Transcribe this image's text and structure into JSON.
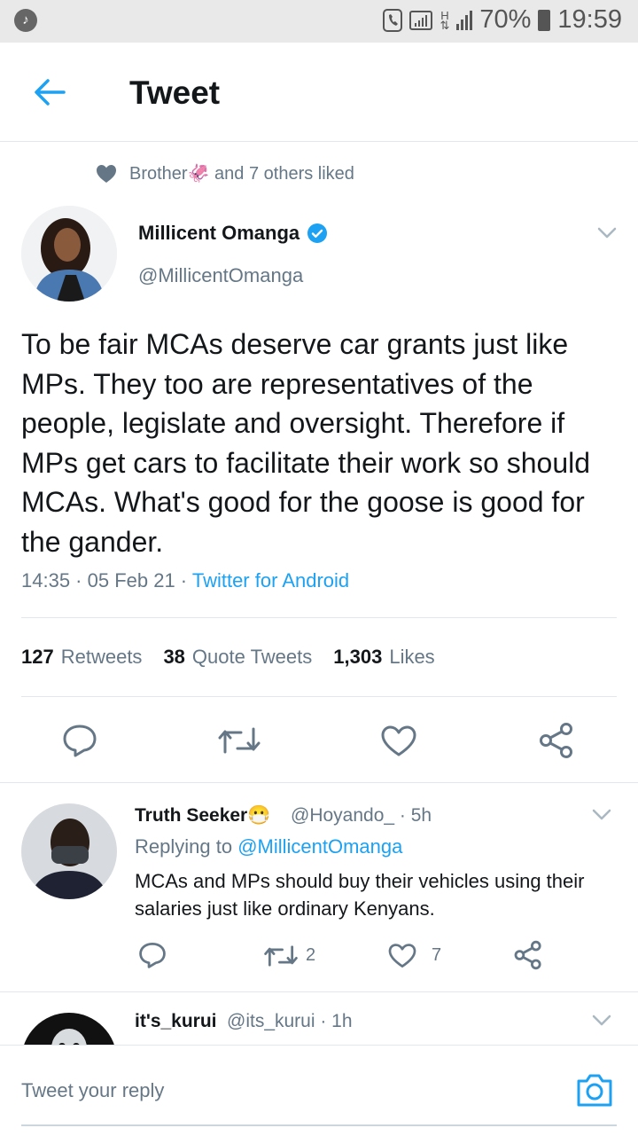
{
  "status_bar": {
    "battery": "70%",
    "time": "19:59",
    "network": "H"
  },
  "header": {
    "title": "Tweet"
  },
  "liked_by": "Brother🦑 and 7 others liked",
  "tweet": {
    "author_name": "Millicent Omanga",
    "author_handle": "@MillicentOmanga",
    "text": "To be fair MCAs deserve car grants just like MPs. They too are representatives of the people, legislate and oversight. Therefore if MPs get cars to facilitate their work so should MCAs. What's good for the goose is good for the gander.",
    "time": "14:35 · 05 Feb 21 · ",
    "source": "Twitter for Android",
    "stats": {
      "retweets_count": "127",
      "retweets_label": "Retweets",
      "quotes_count": "38",
      "quotes_label": "Quote Tweets",
      "likes_count": "1,303",
      "likes_label": "Likes"
    }
  },
  "replies": [
    {
      "name": "Truth Seeker😷",
      "handle": "@Hoyando_ · 5h",
      "replying_prefix": "Replying to ",
      "replying_to": "@MillicentOmanga",
      "text": "MCAs and MPs should buy their vehicles using their salaries just like ordinary Kenyans.",
      "retweets": "2",
      "likes": "7"
    },
    {
      "name": "it's_kurui",
      "handle": "@its_kurui · 1h"
    }
  ],
  "reply_bar": {
    "placeholder": "Tweet your reply"
  },
  "colors": {
    "accent": "#1da1f2",
    "text": "#14171a",
    "muted": "#657786",
    "border": "#e1e8ed"
  }
}
